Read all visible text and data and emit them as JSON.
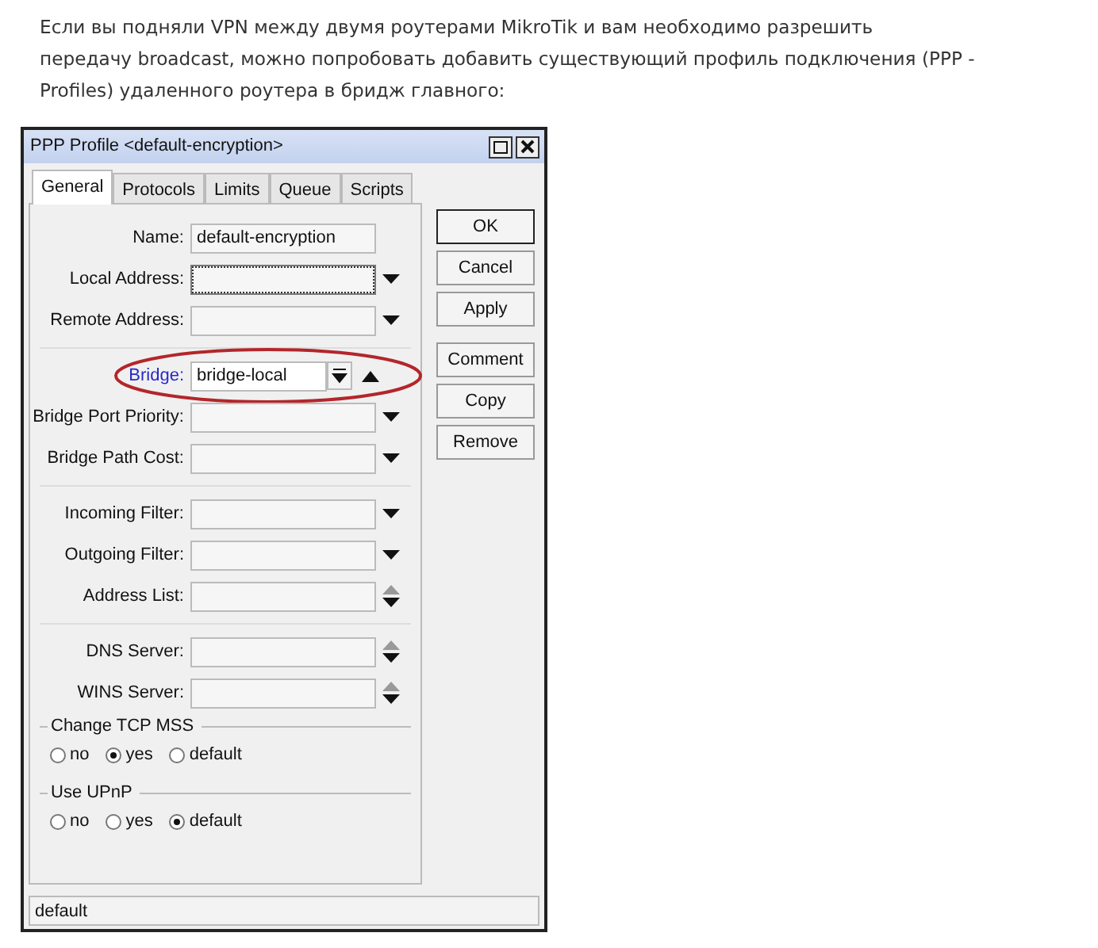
{
  "intro": {
    "lines": [
      "Если вы подняли VPN между двумя роутерами MikroTik и вам необходимо разрешить",
      "передачу broadcast, можно попробовать добавить существующий профиль подключения (PPP -",
      "Profiles) удаленного роутера в бридж главного:"
    ]
  },
  "window": {
    "title": "PPP Profile <default-encryption>",
    "tabs": [
      {
        "label": "General",
        "selected": true
      },
      {
        "label": "Protocols",
        "selected": false
      },
      {
        "label": "Limits",
        "selected": false
      },
      {
        "label": "Queue",
        "selected": false
      },
      {
        "label": "Scripts",
        "selected": false
      }
    ],
    "field_sections": [
      [
        {
          "label": "Name:",
          "value": "default-encryption",
          "kind": "text",
          "focused": false,
          "link": false,
          "highlighted": false
        },
        {
          "label": "Local Address:",
          "kind": "dropdown",
          "focused": true,
          "link": false,
          "highlighted": false
        },
        {
          "label": "Remote Address:",
          "kind": "dropdown",
          "focused": false,
          "link": false,
          "highlighted": false
        }
      ],
      [
        {
          "label": "Bridge:",
          "value": "bridge-local",
          "kind": "combo",
          "focused": false,
          "link": true,
          "highlighted": true
        },
        {
          "label": "Bridge Port Priority:",
          "kind": "dropdown",
          "focused": false,
          "link": false,
          "highlighted": false
        },
        {
          "label": "Bridge Path Cost:",
          "kind": "dropdown",
          "focused": false,
          "link": false,
          "highlighted": false
        }
      ],
      [
        {
          "label": "Incoming Filter:",
          "kind": "dropdown",
          "focused": false,
          "link": false,
          "highlighted": false
        },
        {
          "label": "Outgoing Filter:",
          "kind": "dropdown",
          "focused": false,
          "link": false,
          "highlighted": false
        },
        {
          "label": "Address List:",
          "kind": "spin",
          "focused": false,
          "link": false,
          "highlighted": false
        }
      ],
      [
        {
          "label": "DNS Server:",
          "kind": "spin",
          "focused": false,
          "link": false,
          "highlighted": false
        },
        {
          "label": "WINS Server:",
          "kind": "spin",
          "focused": false,
          "link": false,
          "highlighted": false
        }
      ]
    ],
    "radio_groups": [
      {
        "title": "Change TCP MSS",
        "options": [
          {
            "label": "no",
            "selected": false
          },
          {
            "label": "yes",
            "selected": true
          },
          {
            "label": "default",
            "selected": false
          }
        ]
      },
      {
        "title": "Use UPnP",
        "options": [
          {
            "label": "no",
            "selected": false
          },
          {
            "label": "yes",
            "selected": false
          },
          {
            "label": "default",
            "selected": true
          }
        ]
      }
    ],
    "button_groups": [
      [
        {
          "label": "OK",
          "default": true
        },
        {
          "label": "Cancel",
          "default": false
        },
        {
          "label": "Apply",
          "default": false
        }
      ],
      [
        {
          "label": "Comment",
          "default": false
        },
        {
          "label": "Copy",
          "default": false
        },
        {
          "label": "Remove",
          "default": false
        }
      ]
    ],
    "status_bar": "default"
  }
}
